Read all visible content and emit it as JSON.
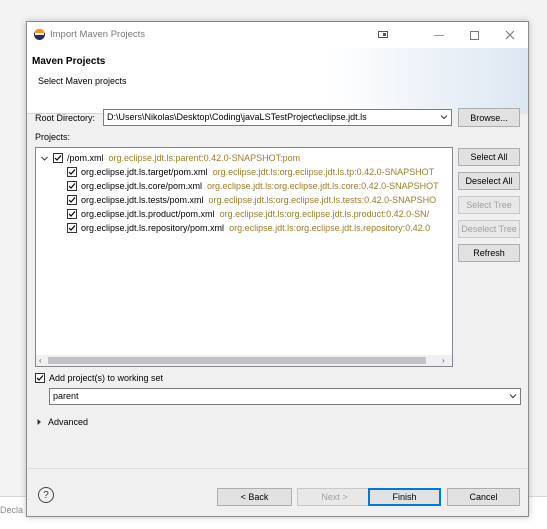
{
  "background": {
    "partial_text": "Decla"
  },
  "window": {
    "title": "Import Maven Projects",
    "controls": {
      "minimize": "—",
      "maximize": "☐",
      "close": "✕"
    }
  },
  "header": {
    "title": "Maven Projects",
    "subtitle": "Select Maven projects"
  },
  "root_directory": {
    "label": "Root Directory:",
    "value": "D:\\Users\\Nikolas\\Desktop\\Coding\\javaLSTestProject\\eclipse.jdt.ls",
    "browse_label": "Browse..."
  },
  "projects": {
    "label": "Projects:",
    "items": [
      {
        "name": "/pom.xml",
        "coord": "org.eclipse.jdt.ls:parent:0.42.0-SNAPSHOT:pom",
        "checked": true,
        "level": 0
      },
      {
        "name": "org.eclipse.jdt.ls.target/pom.xml",
        "coord": "org.eclipse.jdt.ls:org.eclipse.jdt.ls.tp:0.42.0-SNAPSHOT",
        "checked": true,
        "level": 1
      },
      {
        "name": "org.eclipse.jdt.ls.core/pom.xml",
        "coord": "org.eclipse.jdt.ls:org.eclipse.jdt.ls.core:0.42.0-SNAPSHOT",
        "checked": true,
        "level": 1
      },
      {
        "name": "org.eclipse.jdt.ls.tests/pom.xml",
        "coord": "org.eclipse.jdt.ls:org.eclipse.jdt.ls.tests:0.42.0-SNAPSHO",
        "checked": true,
        "level": 1
      },
      {
        "name": "org.eclipse.jdt.ls.product/pom.xml",
        "coord": "org.eclipse.jdt.ls:org.eclipse.jdt.ls.product:0.42.0-SN/",
        "checked": true,
        "level": 1
      },
      {
        "name": "org.eclipse.jdt.ls.repository/pom.xml",
        "coord": "org.eclipse.jdt.ls:org.eclipse.jdt.ls.repository:0.42.0",
        "checked": true,
        "level": 1
      }
    ],
    "side_buttons": {
      "select_all": "Select All",
      "deselect_all": "Deselect All",
      "select_tree": "Select Tree",
      "deselect_tree": "Deselect Tree",
      "refresh": "Refresh"
    }
  },
  "working_set": {
    "checkbox_label": "Add project(s) to working set",
    "checked": true,
    "value": "parent"
  },
  "advanced": {
    "label": "Advanced"
  },
  "footer": {
    "help": "?",
    "back": "< Back",
    "next": "Next >",
    "finish": "Finish",
    "cancel": "Cancel"
  },
  "colors": {
    "coord_text": "#9a7d28",
    "default_button_border": "#0078d7"
  }
}
